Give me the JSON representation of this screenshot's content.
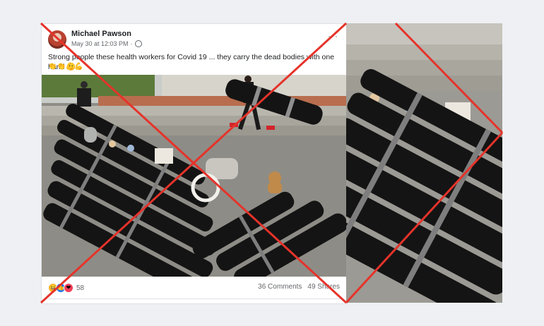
{
  "post": {
    "author": "Michael Pawson",
    "date": "May 30 at 12:03 PM",
    "caption": "Strong people these health workers for Covid 19 ... they carry the dead bodies with one hand 😮",
    "emoji_line": "👏👏💪💪",
    "reaction_count": "58",
    "comments": "36 Comments",
    "shares": "49 Shares",
    "more_icon": "more-options-icon"
  },
  "colors": {
    "cross": "#e5332a",
    "bag": "#141414",
    "tape": "#8f8f8f",
    "pavement": "#8e8c86",
    "grass": "#5c7a3a"
  }
}
